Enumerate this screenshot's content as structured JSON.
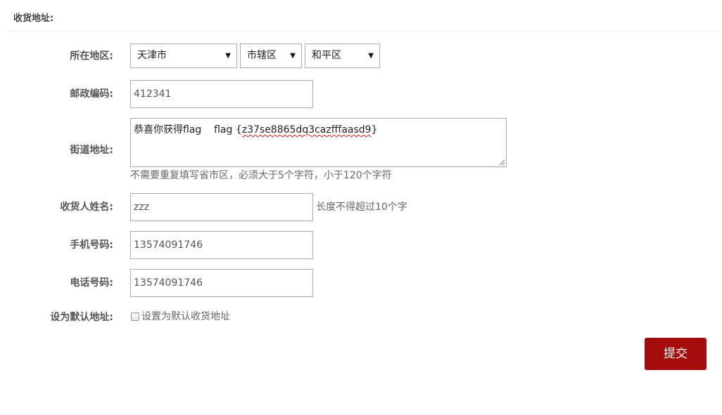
{
  "section": {
    "title": "收货地址:"
  },
  "region": {
    "label": "所在地区:",
    "province": "天津市",
    "city": "市辖区",
    "district": "和平区"
  },
  "postal": {
    "label": "邮政编码:",
    "value": "412341"
  },
  "street": {
    "label": "街道地址:",
    "value_prefix": "恭喜你获得flag    flag {",
    "value_flag": "z37se8865dq3cazfffaasd9",
    "value_suffix": "}",
    "hint": "不需要重复填写省市区，必须大于5个字符，小于120个字符"
  },
  "recipient": {
    "label": "收货人姓名:",
    "value": "zzz",
    "hint": "长度不得超过10个字"
  },
  "mobile": {
    "label": "手机号码:",
    "value": "13574091746"
  },
  "phone": {
    "label": "电话号码:",
    "value": "13574091746"
  },
  "default_address": {
    "label": "设为默认地址:",
    "checkbox_label": "设置为默认收货地址",
    "checked": false
  },
  "submit": {
    "label": "提交"
  },
  "icons": {
    "dropdown": "triangle-down-icon",
    "resize": "resize-grip-icon"
  },
  "colors": {
    "submit_bg": "#a50d0d",
    "border": "#aaaaaa",
    "spellcheck": "#e02020"
  }
}
